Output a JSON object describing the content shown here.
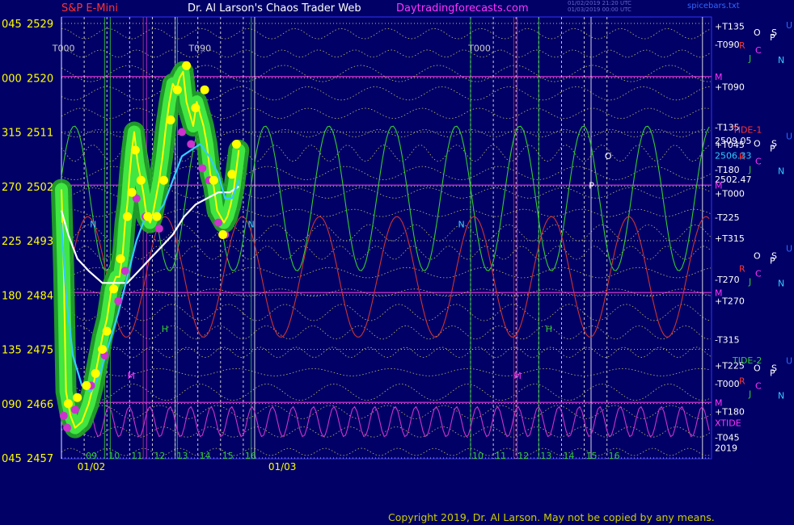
{
  "header": {
    "symbol": "S&P E-Mini",
    "title": "Dr. Al Larson's Chaos Trader Web",
    "site": "Daytradingforecasts.com",
    "stamp_line1": "01/02/2019 21:20 UTC",
    "stamp_line2": "01/03/2019 00:00 UTC",
    "right_label": "spicebars.txt"
  },
  "colors": {
    "background": "#000066",
    "symbol": "#ff3333",
    "title": "#ffffff",
    "site": "#ff33ff",
    "price_line": "#ffff00",
    "price_marker": "#ffff00",
    "glow": "#33dd33",
    "magenta_marker": "#cc33cc",
    "avg_white": "#ffffff",
    "avg_cyan": "#33ccff",
    "copyright": "#cccc00"
  },
  "copyright": "Copyright 2019, Dr. Al Larson. May not be copied by any means.",
  "left_axis": [
    {
      "angle": "045",
      "price": "2529"
    },
    {
      "angle": "000",
      "price": "2520"
    },
    {
      "angle": "315",
      "price": "2511"
    },
    {
      "angle": "270",
      "price": "2502"
    },
    {
      "angle": "225",
      "price": "2493"
    },
    {
      "angle": "180",
      "price": "2484"
    },
    {
      "angle": "135",
      "price": "2475"
    },
    {
      "angle": "090",
      "price": "2466"
    },
    {
      "angle": "045",
      "price": "2457"
    }
  ],
  "right_flux_labels": [
    {
      "text": "+T135",
      "color": "#ffffff",
      "price": 2528.5
    },
    {
      "text": "-T090",
      "color": "#ffffff",
      "price": 2525.5
    },
    {
      "text": "M",
      "color": "#ff33ff",
      "price": 2520.2
    },
    {
      "text": "+T090",
      "color": "#ffffff",
      "price": 2518.5
    },
    {
      "text": "-T135",
      "color": "#ffffff",
      "price": 2511.8
    },
    {
      "text": "2509.05",
      "color": "#ffffff",
      "price": 2509.6
    },
    {
      "text": "+T045",
      "color": "#ffffff",
      "price": 2508.9
    },
    {
      "text": "2506.33",
      "color": "#33ccff",
      "price": 2507.1
    },
    {
      "text": "-T180",
      "color": "#ffffff",
      "price": 2504.8
    },
    {
      "text": "2502.47",
      "color": "#ffffff",
      "price": 2503.2
    },
    {
      "text": "M",
      "color": "#ff33ff",
      "price": 2502.2
    },
    {
      "text": "+T000",
      "color": "#ffffff",
      "price": 2500.8
    },
    {
      "text": "-T225",
      "color": "#ffffff",
      "price": 2496.9
    },
    {
      "text": "+T315",
      "color": "#ffffff",
      "price": 2493.4
    },
    {
      "text": "-T270",
      "color": "#ffffff",
      "price": 2486.6
    },
    {
      "text": "M",
      "color": "#ff33ff",
      "price": 2484.4
    },
    {
      "text": "+T270",
      "color": "#ffffff",
      "price": 2483.0
    },
    {
      "text": "-T315",
      "color": "#ffffff",
      "price": 2476.6
    },
    {
      "text": "+T225",
      "color": "#ffffff",
      "price": 2472.3
    },
    {
      "text": "-T000",
      "color": "#ffffff",
      "price": 2469.3
    },
    {
      "text": "M",
      "color": "#ff33ff",
      "price": 2466.2
    },
    {
      "text": "+T180",
      "color": "#ffffff",
      "price": 2464.7
    },
    {
      "text": "XTIDE",
      "color": "#ff33ff",
      "price": 2462.8
    },
    {
      "text": "-T045",
      "color": "#ffffff",
      "price": 2460.4
    },
    {
      "text": "2019",
      "color": "#ffffff",
      "price": 2458.7
    }
  ],
  "right_markers": [
    {
      "text": "TIDE-1",
      "color": "#ff3333",
      "price": 2511.4
    },
    {
      "text": "TIDE-2",
      "color": "#33cc33",
      "price": 2473.2
    }
  ],
  "planet_groups": [
    {
      "letters": [
        {
          "t": "O",
          "c": "#ffffff"
        },
        {
          "t": "P",
          "c": "#ffffff"
        },
        {
          "t": "S",
          "c": "#ffffff"
        },
        {
          "t": "U",
          "c": "#3366ff"
        },
        {
          "t": "R",
          "c": "#ff3333"
        },
        {
          "t": "C",
          "c": "#ff33ff"
        },
        {
          "t": "J",
          "c": "#33cc33"
        },
        {
          "t": "N",
          "c": "#33ccff"
        }
      ],
      "price": 2527.0
    },
    {
      "letters": [
        {
          "t": "O",
          "c": "#ffffff"
        },
        {
          "t": "P",
          "c": "#ffffff"
        },
        {
          "t": "S",
          "c": "#ffffff"
        },
        {
          "t": "U",
          "c": "#3366ff"
        },
        {
          "t": "R",
          "c": "#ff3333"
        },
        {
          "t": "C",
          "c": "#ff33ff"
        },
        {
          "t": "J",
          "c": "#33cc33"
        },
        {
          "t": "N",
          "c": "#33ccff"
        }
      ],
      "price": 2508.6
    },
    {
      "letters": [
        {
          "t": "O",
          "c": "#ffffff"
        },
        {
          "t": "P",
          "c": "#ffffff"
        },
        {
          "t": "S",
          "c": "#ffffff"
        },
        {
          "t": "U",
          "c": "#3366ff"
        },
        {
          "t": "R",
          "c": "#ff3333"
        },
        {
          "t": "C",
          "c": "#ff33ff"
        },
        {
          "t": "J",
          "c": "#33cc33"
        },
        {
          "t": "N",
          "c": "#33ccff"
        }
      ],
      "price": 2490.0
    },
    {
      "letters": [
        {
          "t": "O",
          "c": "#ffffff"
        },
        {
          "t": "P",
          "c": "#ffffff"
        },
        {
          "t": "S",
          "c": "#ffffff"
        },
        {
          "t": "U",
          "c": "#3366ff"
        },
        {
          "t": "R",
          "c": "#ff3333"
        },
        {
          "t": "C",
          "c": "#ff33ff"
        },
        {
          "t": "J",
          "c": "#33cc33"
        },
        {
          "t": "N",
          "c": "#33ccff"
        }
      ],
      "price": 2471.4
    }
  ],
  "chart_annotations": [
    {
      "text": "T000",
      "color": "#cccccc",
      "time": 7.6,
      "price": 2524.4
    },
    {
      "text": "T090",
      "color": "#cccccc",
      "time": 13.6,
      "price": 2524.4
    },
    {
      "text": "T000",
      "color": "#cccccc",
      "time": 25.9,
      "price": 2524.4
    },
    {
      "text": "N",
      "color": "#33ccff",
      "time": 9.25,
      "price": 2495.2
    },
    {
      "text": "N",
      "color": "#33ccff",
      "time": 16.2,
      "price": 2495.2
    },
    {
      "text": "N",
      "color": "#33ccff",
      "time": 25.45,
      "price": 2495.2
    },
    {
      "text": "M",
      "color": "#ff33ff",
      "time": 10.9,
      "price": 2470.1
    },
    {
      "text": "M",
      "color": "#ff33ff",
      "time": 27.9,
      "price": 2470.1
    },
    {
      "text": "H",
      "color": "#33cc33",
      "time": 12.4,
      "price": 2477.9
    },
    {
      "text": "H",
      "color": "#33cc33",
      "time": 29.3,
      "price": 2477.9
    },
    {
      "text": "P",
      "color": "#ffffff",
      "time": 31.2,
      "price": 2501.6
    },
    {
      "text": "O",
      "color": "#ffffff",
      "time": 31.9,
      "price": 2506.5
    }
  ],
  "chart_data": {
    "type": "line",
    "title": "S&P E-Mini",
    "xlabel": "",
    "ylabel": "",
    "ylim": [
      2457,
      2529
    ],
    "xlim": [
      8,
      36.6
    ],
    "x_ticks": [
      {
        "label": "09",
        "pos": 9
      },
      {
        "label": "10",
        "pos": 10
      },
      {
        "label": "11",
        "pos": 11
      },
      {
        "label": "12",
        "pos": 12
      },
      {
        "label": "13",
        "pos": 13
      },
      {
        "label": "14",
        "pos": 14
      },
      {
        "label": "15",
        "pos": 15
      },
      {
        "label": "16",
        "pos": 16
      },
      {
        "label": "10",
        "pos": 26
      },
      {
        "label": "11",
        "pos": 27
      },
      {
        "label": "12",
        "pos": 28
      },
      {
        "label": "13",
        "pos": 29
      },
      {
        "label": "14",
        "pos": 30
      },
      {
        "label": "15",
        "pos": 31
      },
      {
        "label": "16",
        "pos": 32
      }
    ],
    "date_labels": [
      {
        "label": "01/02",
        "pos": 9.2
      },
      {
        "label": "01/03",
        "pos": 17.6
      }
    ],
    "series": [
      {
        "name": "",
        "style": "price",
        "color": "#ffff00",
        "x": [
          8.0,
          8.1,
          8.2,
          8.4,
          8.6,
          8.9,
          9.2,
          9.4,
          9.6,
          9.8,
          10.0,
          10.2,
          10.4,
          10.55,
          10.7,
          10.8,
          10.9,
          11.0,
          11.1,
          11.2,
          11.35,
          11.5,
          11.6,
          11.75,
          11.9,
          12.0,
          12.15,
          12.3,
          12.45,
          12.6,
          12.75,
          12.9,
          13.05,
          13.2,
          13.35,
          13.5,
          13.65,
          13.8,
          13.95,
          14.1,
          14.25,
          14.4,
          14.55,
          14.7,
          14.85,
          15.0,
          15.15,
          15.3,
          15.45,
          15.6,
          15.7,
          15.8
        ],
        "y": [
          2501.5,
          2488,
          2468,
          2464,
          2462,
          2463,
          2466,
          2469,
          2473,
          2477,
          2480,
          2485,
          2487,
          2487,
          2491,
          2496,
          2499,
          2504,
          2508,
          2511,
          2506,
          2503,
          2501,
          2497,
          2496,
          2497,
          2500,
          2503,
          2507,
          2512,
          2516,
          2519,
          2518,
          2520,
          2521,
          2516,
          2514,
          2512,
          2516,
          2514,
          2512,
          2509,
          2504,
          2502,
          2498,
          2497,
          2496,
          2497,
          2499,
          2502,
          2505,
          2508
        ]
      },
      {
        "name": "",
        "style": "avg",
        "color": "#ffffff",
        "x": [
          8.0,
          8.3,
          8.7,
          9.2,
          9.8,
          10.4,
          10.9,
          11.4,
          11.9,
          12.4,
          12.9,
          13.4,
          13.9,
          14.4,
          14.9,
          15.4,
          15.8
        ],
        "y": [
          2498,
          2494,
          2490,
          2488,
          2486,
          2486,
          2486,
          2488,
          2490,
          2492,
          2494,
          2497,
          2499,
          2500,
          2501,
          2501,
          2502
        ]
      },
      {
        "name": "",
        "style": "avg",
        "color": "#33ccff",
        "x": [
          8.0,
          8.2,
          8.5,
          8.9,
          9.3,
          9.7,
          10.1,
          10.5,
          10.9,
          11.3,
          11.7,
          12.1,
          12.5,
          12.9,
          13.3,
          13.7,
          14.1,
          14.5,
          14.9,
          15.2,
          15.5,
          15.8
        ],
        "y": [
          2496,
          2484,
          2474,
          2469,
          2468,
          2471,
          2476,
          2481,
          2487,
          2493,
          2497,
          2497,
          2499,
          2503,
          2507,
          2508,
          2509,
          2507,
          2504,
          2500,
          2500,
          2503
        ]
      }
    ],
    "markers": {
      "yellow": [
        [
          8.3,
          2466
        ],
        [
          8.7,
          2467
        ],
        [
          9.1,
          2469
        ],
        [
          9.5,
          2471
        ],
        [
          9.8,
          2475
        ],
        [
          10.0,
          2478
        ],
        [
          10.3,
          2485
        ],
        [
          10.6,
          2490
        ],
        [
          10.9,
          2497
        ],
        [
          11.1,
          2501
        ],
        [
          11.25,
          2508
        ],
        [
          11.5,
          2503
        ],
        [
          11.8,
          2497
        ],
        [
          12.2,
          2497
        ],
        [
          12.5,
          2503
        ],
        [
          12.8,
          2513
        ],
        [
          13.1,
          2518
        ],
        [
          13.5,
          2522
        ],
        [
          13.9,
          2515
        ],
        [
          14.3,
          2518
        ],
        [
          14.7,
          2503
        ],
        [
          15.1,
          2494
        ],
        [
          15.5,
          2504
        ],
        [
          15.7,
          2509
        ]
      ],
      "magenta": [
        [
          8.1,
          2464
        ],
        [
          8.25,
          2462
        ],
        [
          8.6,
          2465
        ],
        [
          9.3,
          2469
        ],
        [
          9.9,
          2474
        ],
        [
          10.5,
          2483
        ],
        [
          10.8,
          2488
        ],
        [
          11.3,
          2500
        ],
        [
          11.7,
          2497
        ],
        [
          12.3,
          2495
        ],
        [
          13.3,
          2511
        ],
        [
          13.7,
          2509
        ],
        [
          14.2,
          2505
        ],
        [
          14.5,
          2503
        ],
        [
          14.9,
          2496
        ],
        [
          15.2,
          2494
        ]
      ],
      "glow_band_price": [
        2462,
        2463,
        2466,
        2469,
        2473,
        2477,
        2480,
        2485,
        2487,
        2491,
        2496,
        2499,
        2504,
        2508,
        2511,
        2506,
        2503,
        2501,
        2497,
        2496,
        2497,
        2500,
        2503,
        2507,
        2512,
        2516,
        2519,
        2518,
        2520,
        2521,
        2516,
        2514,
        2512,
        2516,
        2514,
        2512,
        2509,
        2504,
        2502,
        2498,
        2497,
        2496,
        2497,
        2499,
        2502,
        2505,
        2508
      ]
    }
  }
}
